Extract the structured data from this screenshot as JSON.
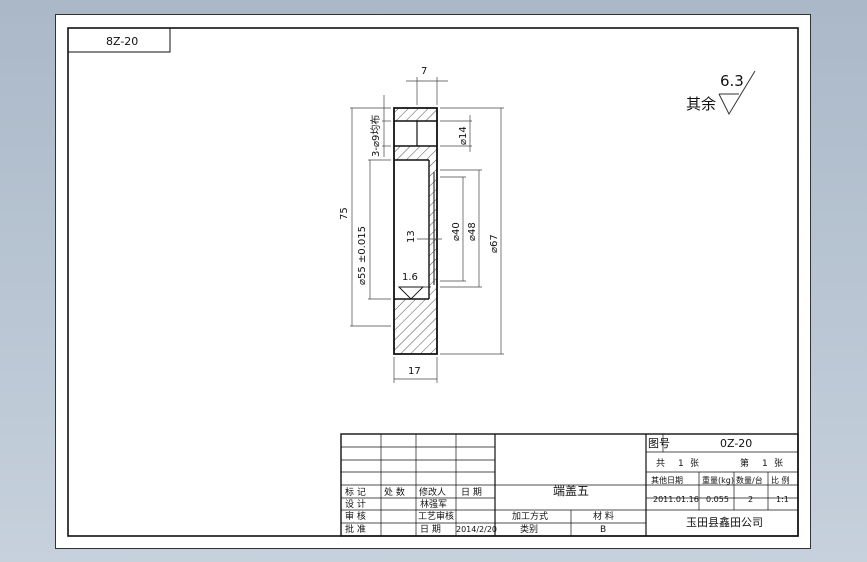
{
  "drawing_code": "8Z-20",
  "roughness": {
    "prefix": "其余",
    "value": "6.3"
  },
  "part": {
    "dims": {
      "width_top": "7",
      "width_bottom": "17",
      "total_height": "75",
      "bore_fit": "⌀55 ±0.015",
      "holes": "3-⌀9均布",
      "d14": "⌀14",
      "d40": "⌀40",
      "d48": "⌀48",
      "d67": "⌀67",
      "step": "13",
      "surface_roughness": "1.6"
    }
  },
  "title_block": {
    "rev_headers": [
      "标 记",
      "处 数",
      "修改人",
      "日 期"
    ],
    "design": {
      "label": "设 计",
      "value": "林强军"
    },
    "review": {
      "label": "审 核",
      "value": "工艺审核"
    },
    "approve": {
      "label": "批 准",
      "date_label": "日 期",
      "date": "2014/2/20"
    },
    "part_name": "端盖五",
    "process_label": "加工方式",
    "material_label": "材 料",
    "category_label": "类别",
    "material_value": "B",
    "drawing_no_label": "图号",
    "drawing_no": "0Z-20",
    "sheets": {
      "total_label": "共",
      "total": "1",
      "total_unit": "张",
      "page_label": "第",
      "page": "1",
      "page_unit": "张"
    },
    "headers": [
      "其他日期",
      "重量(kg)",
      "数量/台",
      "比 例"
    ],
    "values": [
      "2011.01.16",
      "0.055",
      "2",
      "1:1"
    ],
    "company": "玉田县鑫田公司"
  }
}
